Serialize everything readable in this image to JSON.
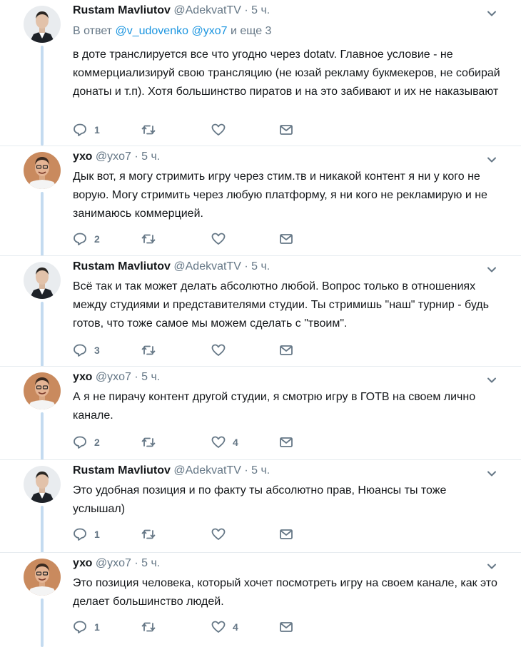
{
  "tweets": [
    {
      "name": "Rustam Mavliutov",
      "handle": "@AdekvatTV",
      "time": "5 ч.",
      "reply_prefix": "В ответ",
      "reply_mentions": "@v_udovenko @yxo7",
      "reply_suffix": "и еще 3",
      "text": "в доте транслируется все что угодно через dotatv. Главное условие - не коммерциализируй свою трансляцию (не юзай рекламу букмекеров, не собирай донаты и т.п). Хотя большинство пиратов и на это забивают и их не наказывают",
      "replies": "1",
      "retweets": "",
      "likes": "",
      "avatar": "suit-man-avatar"
    },
    {
      "name": "ухо",
      "handle": "@yxo7",
      "time": "5 ч.",
      "text": "Дык вот, я могу стримить игру через стим.тв и никакой контент я ни у кого не ворую. Могу стримить через любую платформу, я ни кого не рекламирую и не занимаюсь коммерцией.",
      "replies": "2",
      "retweets": "",
      "likes": "",
      "avatar": "smiling-man-avatar"
    },
    {
      "name": "Rustam Mavliutov",
      "handle": "@AdekvatTV",
      "time": "5 ч.",
      "text": "Всё так и так может делать абсолютно любой. Вопрос только в отношениях между студиями и представителями студии. Ты стримишь \"наш\" турнир - будь готов, что тоже самое мы можем сделать с \"твоим\".",
      "replies": "3",
      "retweets": "",
      "likes": "",
      "avatar": "suit-man-avatar"
    },
    {
      "name": "ухо",
      "handle": "@yxo7",
      "time": "5 ч.",
      "text": "А я не пирачу контент другой студии, я смотрю игру в ГОТВ на своем лично канале.",
      "replies": "2",
      "retweets": "",
      "likes": "4",
      "avatar": "smiling-man-avatar"
    },
    {
      "name": "Rustam Mavliutov",
      "handle": "@AdekvatTV",
      "time": "5 ч.",
      "text": "Это удобная позиция и по факту ты абсолютно прав, Нюансы ты тоже услышал)",
      "replies": "1",
      "retweets": "",
      "likes": "",
      "avatar": "suit-man-avatar"
    },
    {
      "name": "ухо",
      "handle": "@yxo7",
      "time": "5 ч.",
      "text": "Это позиция человека, который хочет посмотреть игру на своем канале, как это делает большинство людей.",
      "replies": "1",
      "retweets": "",
      "likes": "4",
      "avatar": "smiling-man-avatar"
    }
  ],
  "colors": {
    "accent": "#1b95e0",
    "muted": "#657786",
    "thread_line": "#c4dbf0",
    "divider": "#e6ecf0"
  }
}
